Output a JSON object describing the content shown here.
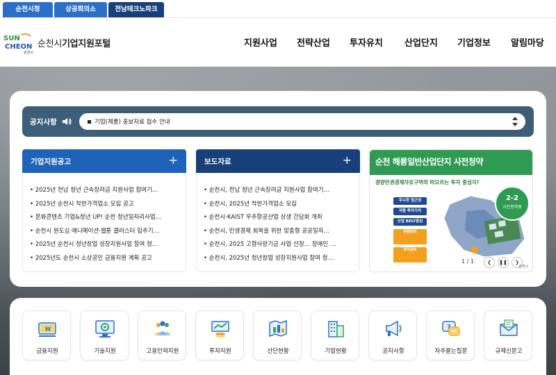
{
  "top_tabs": [
    {
      "label": "순천시청"
    },
    {
      "label": "상공회의소"
    },
    {
      "label": "전남테크노파크"
    }
  ],
  "header": {
    "logo_word": "SUN CHEON",
    "logo_sub": "순천시",
    "portal_title_prefix": "순천시",
    "portal_title_main": "기업지원포털",
    "nav": [
      "지원사업",
      "전략산업",
      "투자유치",
      "산업단지",
      "기업정보",
      "알림마당"
    ]
  },
  "notice": {
    "label": "공지사항",
    "text": "기업(제품) 홍보자료 접수 안내"
  },
  "boards": [
    {
      "title": "기업지원공고",
      "items": [
        "2025년 전남 청년 근속장려금 지원사업 참여기…",
        "2025년 순천시 착한가격업소 모집 공고",
        "문화콘텐츠 기업&청년 UP! 순천 청년일자리사업…",
        "순천시 원도심 애니메이션·웹툰 클러스터 입주기…",
        "2025년 순천시 청년창업 성장지원사업 참여 청…",
        "2025년도 순천시 소상공인 금융지원 계획 공고"
      ]
    },
    {
      "title": "보도자료",
      "items": [
        "순천시, 전남 청년 근속장려금 지원사업 참여기…",
        "순천시, 2025년 착한가격업소 모집",
        "순천시·KAIST 우주항공산업 상생 간담회 개최",
        "순천시, 민생경제 회복을 위한 맞춤형 공공일자…",
        "순천시, 2025 고향사랑기금 사업 선정… 장애인 …",
        "순천시, 2025년 청년창업 성장지원사업 참여 청…"
      ]
    }
  ],
  "banner": {
    "title": "순천 해룡일반산업단지 사전청약",
    "subtitle": "광양만권경제자유구역의 떠오르는 투자 중심지!",
    "badge_num": "2-2",
    "badge_text": "사전청약중",
    "chips": [
      "우수한 접근성",
      "저렴 투자가치",
      "산업 BELT중심"
    ],
    "contact1": "분양문의",
    "contact2": "투자문의",
    "pager": "1 / 1",
    "brand": "순천시"
  },
  "quick_links": [
    {
      "label": "금융지원",
      "icon": "money-icon"
    },
    {
      "label": "기술지원",
      "icon": "tech-monitor-icon"
    },
    {
      "label": "고용인력지원",
      "icon": "people-icon"
    },
    {
      "label": "투자지원",
      "icon": "coins-chart-icon"
    },
    {
      "label": "산단현황",
      "icon": "industrial-map-icon"
    },
    {
      "label": "기업현황",
      "icon": "building-icon"
    },
    {
      "label": "공지사항",
      "icon": "megaphone-icon"
    },
    {
      "label": "자주묻는질문",
      "icon": "faq-icon"
    },
    {
      "label": "규제신문고",
      "icon": "mail-report-icon"
    }
  ],
  "colors": {
    "tab_blue": "#2b6fc9",
    "tab_dark": "#173f7a",
    "notice_bg": "#3d5e79",
    "board1_head": "#1e63b8",
    "board2_head": "#173f7a",
    "banner_green": "#2e9a52"
  }
}
